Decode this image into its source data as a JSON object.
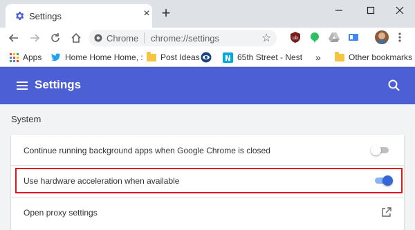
{
  "window": {
    "tab_title": "Settings",
    "tab_icon": "gear-icon",
    "new_tab_label": "+",
    "controls": [
      "minimize-icon",
      "maximize-icon",
      "close-icon"
    ]
  },
  "toolbar": {
    "omnibox_chip": "Chrome",
    "url": "chrome://settings",
    "icons": [
      "back-arrow-icon",
      "forward-arrow-icon",
      "reload-icon",
      "home-icon",
      "star-icon",
      "ublock-icon",
      "evernote-icon",
      "drive-icon",
      "extension-icon",
      "avatar",
      "more-vert-icon"
    ]
  },
  "bookmarks": {
    "items": [
      {
        "label": "Apps",
        "icon": "apps-grid-icon"
      },
      {
        "label": "Home Home Home, :",
        "icon": "twitter-bird-icon"
      },
      {
        "label": "Post Ideas",
        "icon": "folder-icon"
      },
      {
        "label": "",
        "icon": "eye-icon"
      },
      {
        "label": "65th Street - Nest",
        "icon": "nest-icon"
      }
    ],
    "overflow_label": "»",
    "other_bookmarks": "Other bookmarks"
  },
  "header": {
    "title": "Settings",
    "menu_icon": "hamburger-menu-icon",
    "search_icon": "search-icon",
    "color": "#4c5fd5"
  },
  "system": {
    "section_title": "System",
    "rows": [
      {
        "label": "Continue running background apps when Google Chrome is closed",
        "control": "toggle",
        "enabled": false
      },
      {
        "label": "Use hardware acceleration when available",
        "control": "toggle",
        "enabled": true
      },
      {
        "label": "Open proxy settings",
        "control": "external-link"
      }
    ]
  },
  "colors": {
    "accent": "#4c5fd5",
    "toggle_on": "#3367d6",
    "highlight": "#e4131b"
  }
}
